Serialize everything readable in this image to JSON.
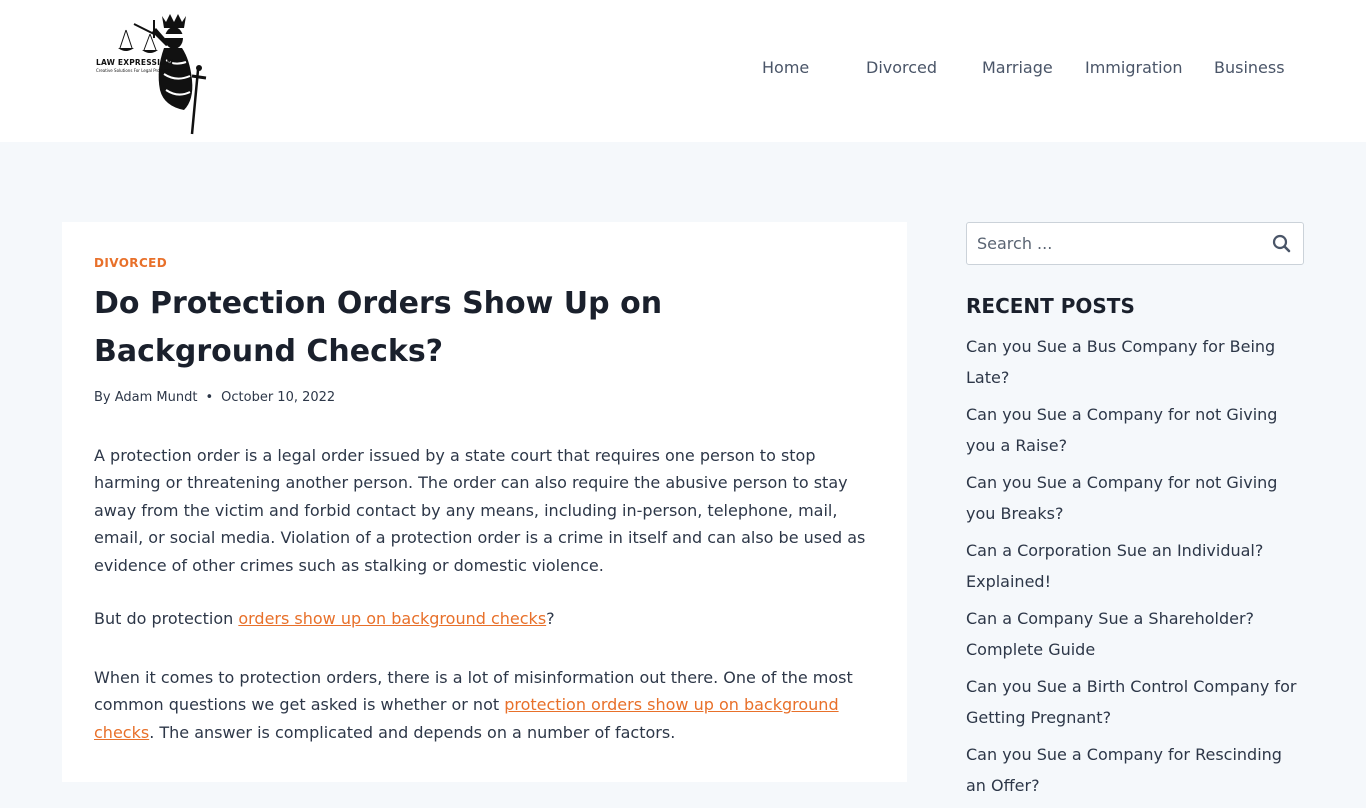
{
  "header": {
    "logo_text": "LAW EXPRESSION",
    "logo_tagline": "Creative Solutions For Legal Problems",
    "nav": [
      "Home",
      "Divorced",
      "Marriage",
      "Immigration",
      "Business"
    ]
  },
  "article": {
    "category": "DIVORCED",
    "title": "Do Protection Orders Show Up on Background Checks?",
    "meta": {
      "author": "By Adam Mundt",
      "date": "October 10, 2022"
    },
    "p1": "A protection order is a legal order issued by a state court that requires one person to stop harming or threatening another person. The order can also require the abusive person to stay away from the victim and forbid contact by any means, including in-person, telephone, mail, email, or social media. Violation of a protection order is a crime in itself and can also be used as evidence of other crimes such as stalking or domestic violence.",
    "p2_before": "But do protection ",
    "p2_link": "orders show up on background checks",
    "p2_after": "?",
    "p3_before": "When it comes to protection orders, there is a lot of misinformation out there. One of the most common questions we get asked is whether or not ",
    "p3_link": "protection orders show up on background checks",
    "p3_after": ". The answer is complicated and depends on a number of factors."
  },
  "sidebar": {
    "search_placeholder": "Search ...",
    "recent_title": "RECENT POSTS",
    "recent_posts": [
      "Can you Sue a Bus Company for Being Late?",
      "Can you Sue a Company for not Giving you a Raise?",
      "Can you Sue a Company for not Giving you Breaks?",
      "Can a Corporation Sue an Individual? Explained!",
      "Can a Company Sue a Shareholder? Complete Guide",
      "Can you Sue a Birth Control Company for Getting Pregnant?",
      "Can you Sue a Company for Rescinding an Offer?"
    ]
  },
  "colors": {
    "accent": "#e8702a",
    "page_bg": "#f5f8fb",
    "heading": "#1a202c"
  }
}
